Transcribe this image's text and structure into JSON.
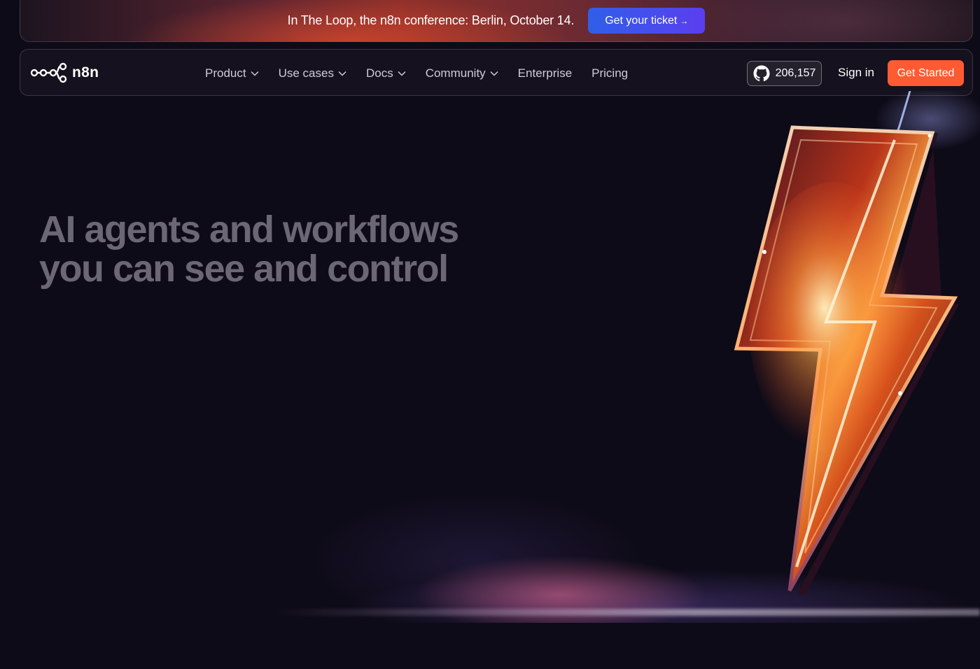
{
  "banner": {
    "text": "In The Loop, the n8n conference: Berlin, October 14.",
    "button_label": "Get your ticket",
    "button_arrow": "→"
  },
  "nav": {
    "logo_text": "n8n",
    "links": [
      {
        "label": "Product",
        "has_dropdown": true
      },
      {
        "label": "Use cases",
        "has_dropdown": true
      },
      {
        "label": "Docs",
        "has_dropdown": true
      },
      {
        "label": "Community",
        "has_dropdown": true
      },
      {
        "label": "Enterprise",
        "has_dropdown": false
      },
      {
        "label": "Pricing",
        "has_dropdown": false
      }
    ],
    "github_stars": "206,157",
    "sign_in": "Sign in",
    "get_started": "Get Started"
  },
  "hero": {
    "title_line1": "AI agents and workflows",
    "title_line2": "you can see and control"
  },
  "colors": {
    "background": "#0e0b18",
    "accent_orange": "#fe5b33",
    "ticket_blue": "#2f5fe8",
    "hero_text": "#6b6775"
  },
  "icons": [
    "n8n-logo-icon",
    "github-icon",
    "chevron-down-icon",
    "lightning-bolt-illustration"
  ]
}
